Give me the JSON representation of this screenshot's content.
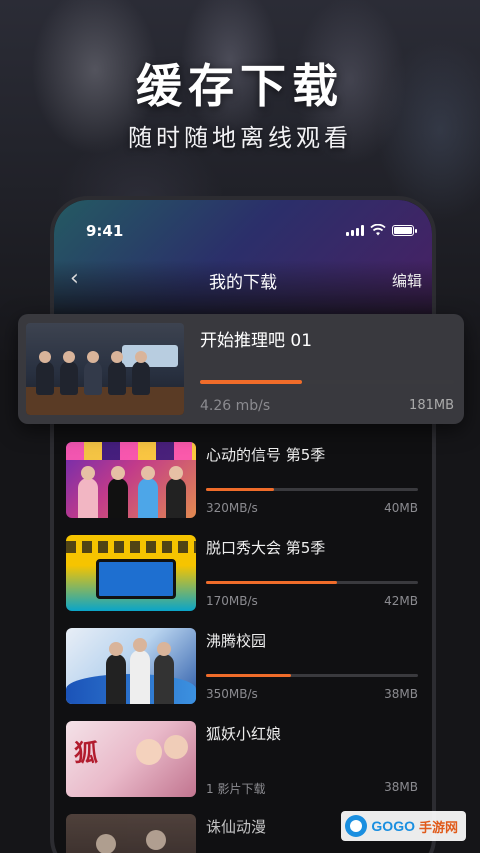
{
  "hero": {
    "title": "缓存下载",
    "subtitle": "随时随地离线观看"
  },
  "status_bar": {
    "time": "9:41"
  },
  "nav": {
    "back_icon": "chevron-left-icon",
    "title": "我的下载",
    "edit_label": "编辑"
  },
  "downloads": [
    {
      "name": "开始推理吧 01",
      "speed": "4.26 mb/s",
      "size": "181MB",
      "progress": 0.4
    },
    {
      "name": "心动的信号 第5季",
      "speed": "320MB/s",
      "size": "40MB",
      "progress": 0.32
    },
    {
      "name": "脱口秀大会 第5季",
      "speed": "170MB/s",
      "size": "42MB",
      "progress": 0.62
    },
    {
      "name": "沸腾校园",
      "speed": "350MB/s",
      "size": "38MB",
      "progress": 0.4
    },
    {
      "name": "狐妖小红娘",
      "speed": "1 影片下载",
      "size": "38MB",
      "progress": 0
    },
    {
      "name": "诛仙动漫",
      "speed": "",
      "size": "",
      "progress": 0
    }
  ],
  "colors": {
    "accent": "#f06c2a",
    "track": "#3a3a3e"
  },
  "watermark": {
    "text": "GOGO",
    "text2": "手游网"
  }
}
